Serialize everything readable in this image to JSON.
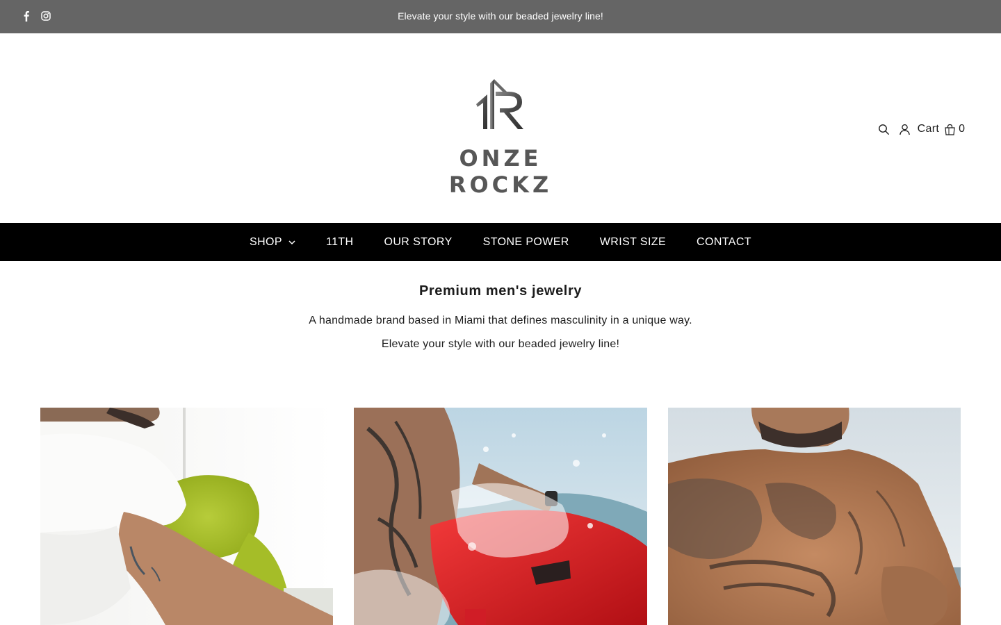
{
  "announcement": {
    "message": "Elevate your style with our beaded jewelry line!",
    "social_icons": [
      "facebook-icon",
      "instagram-icon"
    ]
  },
  "header": {
    "logo_text": "ONZE ROCKZ",
    "tools": {
      "search_icon": "search-icon",
      "account_icon": "account-icon",
      "cart_label": "Cart",
      "cart_icon": "shopping-bag-icon",
      "cart_count": "0"
    }
  },
  "nav": {
    "items": [
      {
        "label": "SHOP",
        "has_dropdown": true
      },
      {
        "label": "11TH"
      },
      {
        "label": "OUR STORY"
      },
      {
        "label": "STONE POWER"
      },
      {
        "label": "WRIST SIZE"
      },
      {
        "label": "CONTACT"
      }
    ]
  },
  "intro": {
    "heading": "Premium men's jewelry",
    "line1": "A handmade brand based in Miami that defines masculinity in a unique way.",
    "line2": "Elevate your style with our beaded jewelry line!"
  },
  "colors": {
    "announcement_bg": "#656565",
    "nav_bg": "#000000",
    "logo_gray": "#575757",
    "text": "#1c1c1c"
  }
}
